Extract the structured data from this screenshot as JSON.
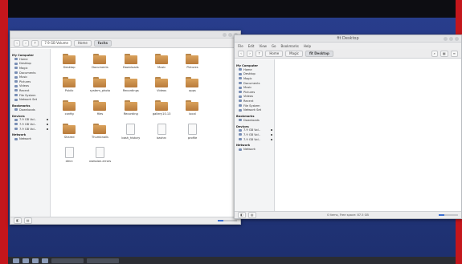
{
  "left_window": {
    "title": "",
    "path": "7.9 GB Volume",
    "crumbs": [
      "Home",
      "fuchs"
    ],
    "sidebar": {
      "sections": [
        {
          "heading": "My Computer",
          "items": [
            "Home",
            "Desktop",
            "Magic",
            "Documents",
            "Music",
            "Pictures",
            "Videos",
            "Recent",
            "File System",
            "Network Set"
          ]
        },
        {
          "heading": "Bookmarks",
          "items": [
            "Downloads"
          ]
        },
        {
          "heading": "Devices",
          "items": [
            "7.9 GB Vol..",
            "7.9 GB Vol..",
            "7.9 GB Vol.."
          ]
        },
        {
          "heading": "Network",
          "items": [
            "Network"
          ]
        }
      ]
    },
    "files": [
      {
        "name": "Desktop",
        "kind": "folder"
      },
      {
        "name": "Documents",
        "kind": "folder"
      },
      {
        "name": "Downloads",
        "kind": "folder"
      },
      {
        "name": "Music",
        "kind": "folder"
      },
      {
        "name": "Pictures",
        "kind": "folder"
      },
      {
        "name": "",
        "kind": "spacer"
      },
      {
        "name": "Public",
        "kind": "folder"
      },
      {
        "name": "system_photo",
        "kind": "folder"
      },
      {
        "name": "Recordings",
        "kind": "folder"
      },
      {
        "name": "Videos",
        "kind": "folder"
      },
      {
        "name": "apps",
        "kind": "folder"
      },
      {
        "name": "",
        "kind": "spacer"
      },
      {
        "name": "config",
        "kind": "folder"
      },
      {
        "name": "files",
        "kind": "folder"
      },
      {
        "name": "Recording",
        "kind": "folder"
      },
      {
        "name": "gallery10.13",
        "kind": "folder"
      },
      {
        "name": "local",
        "kind": "folder"
      },
      {
        "name": "",
        "kind": "spacer"
      },
      {
        "name": "Shared",
        "kind": "folder"
      },
      {
        "name": "Thumbnails",
        "kind": "folder"
      },
      {
        "name": "bash_history",
        "kind": "doc"
      },
      {
        "name": "bashrc",
        "kind": "doc"
      },
      {
        "name": "profile",
        "kind": "doc"
      },
      {
        "name": "",
        "kind": "spacer"
      },
      {
        "name": "dmrc",
        "kind": "doc"
      },
      {
        "name": "xsession-errors",
        "kind": "doc"
      }
    ],
    "status": "",
    "zoom_fraction": 0.3
  },
  "right_window": {
    "title": "fit Desktop",
    "menu": [
      "File",
      "Edit",
      "View",
      "Go",
      "Bookmarks",
      "Help"
    ],
    "crumbs": [
      "Home",
      "Magic",
      "fit Desktop"
    ],
    "sidebar": {
      "sections": [
        {
          "heading": "My Computer",
          "items": [
            "Home",
            "Desktop",
            "Magic",
            "Documents",
            "Music",
            "Pictures",
            "Videos",
            "Recent",
            "File System",
            "Network Set"
          ]
        },
        {
          "heading": "Bookmarks",
          "items": [
            "Downloads"
          ]
        },
        {
          "heading": "Devices",
          "items": [
            "7.9 GB Vol..",
            "7.9 GB Vol..",
            "7.9 GB Vol.."
          ]
        },
        {
          "heading": "Network",
          "items": [
            "Network"
          ]
        }
      ]
    },
    "status": "0 items, Free space: 87.5 GB",
    "zoom_fraction": 0.3
  },
  "taskbar": {
    "clock": ""
  }
}
